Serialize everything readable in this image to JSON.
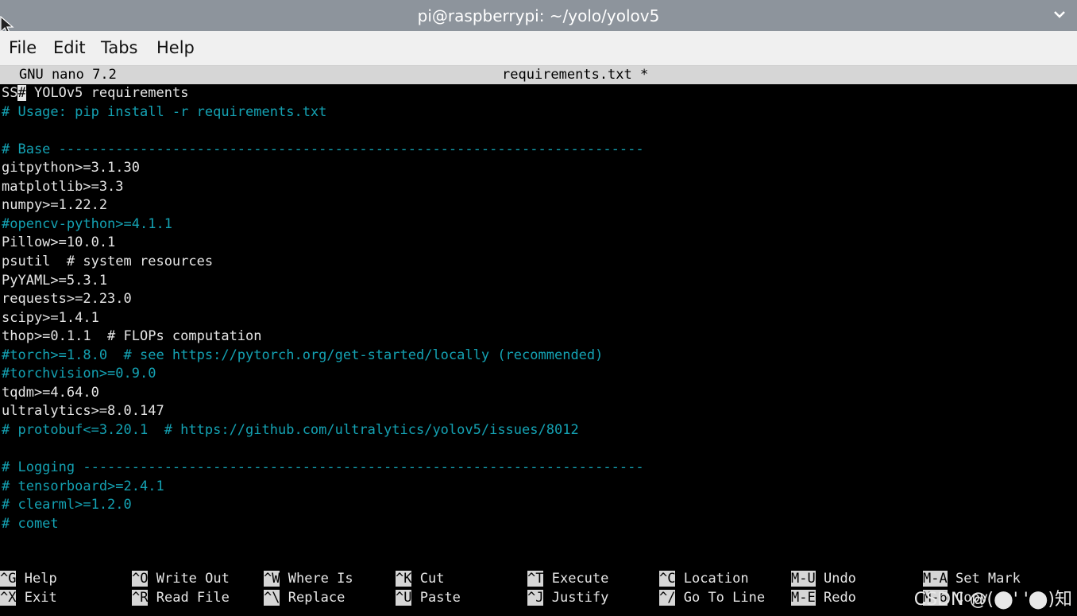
{
  "window": {
    "title": "pi@raspberrypi: ~/yolo/yolov5"
  },
  "menu": {
    "items": [
      "File",
      "Edit",
      "Tabs",
      "Help"
    ]
  },
  "nano": {
    "version": "GNU nano 7.2",
    "filename": "requirements.txt *",
    "cursor_prefix": "SS",
    "cursor_char": "#",
    "first_line_rest": " YOLOv5 requirements",
    "lines": [
      {
        "text": "# Usage: pip install -r requirements.txt",
        "color": "cyan"
      },
      {
        "text": "",
        "color": "white"
      },
      {
        "text": "# Base ------------------------------------------------------------------------",
        "color": "cyan"
      },
      {
        "text": "gitpython>=3.1.30",
        "color": "white"
      },
      {
        "text": "matplotlib>=3.3",
        "color": "white"
      },
      {
        "text": "numpy>=1.22.2",
        "color": "white"
      },
      {
        "text": "#opencv-python>=4.1.1",
        "color": "cyan"
      },
      {
        "text": "Pillow>=10.0.1",
        "color": "white"
      },
      {
        "text": "psutil  # system resources",
        "color": "white"
      },
      {
        "text": "PyYAML>=5.3.1",
        "color": "white"
      },
      {
        "text": "requests>=2.23.0",
        "color": "white"
      },
      {
        "text": "scipy>=1.4.1",
        "color": "white"
      },
      {
        "text": "thop>=0.1.1  # FLOPs computation",
        "color": "white"
      },
      {
        "text": "#torch>=1.8.0  # see https://pytorch.org/get-started/locally (recommended)",
        "color": "cyan"
      },
      {
        "text": "#torchvision>=0.9.0",
        "color": "cyan"
      },
      {
        "text": "tqdm>=4.64.0",
        "color": "white"
      },
      {
        "text": "ultralytics>=8.0.147",
        "color": "white"
      },
      {
        "text": "# protobuf<=3.20.1  # https://github.com/ultralytics/yolov5/issues/8012",
        "color": "cyan"
      },
      {
        "text": "",
        "color": "white"
      },
      {
        "text": "# Logging ---------------------------------------------------------------------",
        "color": "cyan"
      },
      {
        "text": "# tensorboard>=2.4.1",
        "color": "cyan"
      },
      {
        "text": "# clearml>=1.2.0",
        "color": "cyan"
      },
      {
        "text": "# comet",
        "color": "cyan"
      }
    ],
    "shortcuts": [
      {
        "key": "^G",
        "label": "Help"
      },
      {
        "key": "^O",
        "label": "Write Out"
      },
      {
        "key": "^W",
        "label": "Where Is"
      },
      {
        "key": "^K",
        "label": "Cut"
      },
      {
        "key": "^T",
        "label": "Execute"
      },
      {
        "key": "^C",
        "label": "Location"
      },
      {
        "key": "M-U",
        "label": "Undo"
      },
      {
        "key": "M-A",
        "label": "Set Mark"
      },
      {
        "key": "^X",
        "label": "Exit"
      },
      {
        "key": "^R",
        "label": "Read File"
      },
      {
        "key": "^\\",
        "label": "Replace"
      },
      {
        "key": "^U",
        "label": "Paste"
      },
      {
        "key": "^J",
        "label": "Justify"
      },
      {
        "key": "^/",
        "label": "Go To Line"
      },
      {
        "key": "M-E",
        "label": "Redo"
      },
      {
        "key": "M-6",
        "label": "Copy"
      }
    ]
  },
  "watermark": "CSDN @(⬤' '⬤)知",
  "colors": {
    "comment": "#14a2b3",
    "text": "#e6e6e6",
    "header_bg": "#d6d6d6",
    "titlebar_bg": "#8d949c"
  }
}
